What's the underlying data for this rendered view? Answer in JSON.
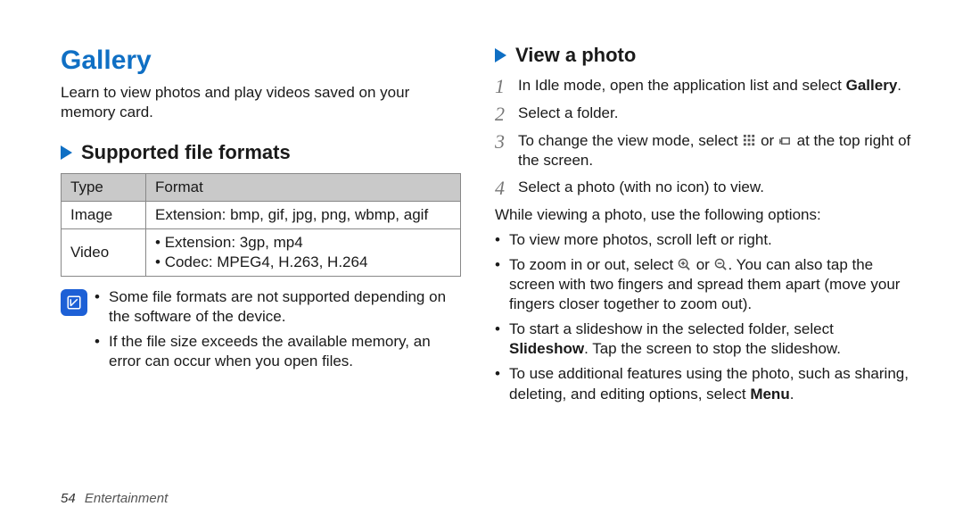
{
  "left": {
    "title": "Gallery",
    "intro": "Learn to view photos and play videos saved on your memory card.",
    "section_heading": "Supported file formats",
    "table": {
      "head_type": "Type",
      "head_format": "Format",
      "row_image_type": "Image",
      "row_image_format": "Extension: bmp, gif, jpg, png, wbmp, agif",
      "row_video_type": "Video",
      "row_video_b1": "Extension: 3gp, mp4",
      "row_video_b2": "Codec: MPEG4, H.263, H.264"
    },
    "notes": {
      "n1": "Some file formats are not supported depending on the software of the device.",
      "n2": "If the file size exceeds the available memory, an error can occur when you open files."
    }
  },
  "right": {
    "section_heading": "View a photo",
    "steps": {
      "s1_pre": "In Idle mode, open the application list and select ",
      "s1_bold": "Gallery",
      "s1_post": ".",
      "s2": "Select a folder.",
      "s3_pre": "To change the view mode, select ",
      "s3_mid": " or ",
      "s3_post": " at the top right of the screen.",
      "s4": "Select a photo (with no icon) to view."
    },
    "options_lead": "While viewing a photo, use the following options:",
    "opts": {
      "o1": "To view more photos, scroll left or right.",
      "o2_pre": "To zoom in or out, select ",
      "o2_mid": " or ",
      "o2_post": ". You can also tap the screen with two fingers and spread them apart (move your fingers closer together to zoom out).",
      "o3_pre": "To start a slideshow in the selected folder, select ",
      "o3_bold": "Slideshow",
      "o3_post": ". Tap the screen to stop the slideshow.",
      "o4_pre": "To use additional features using the photo, such as sharing, deleting, and editing options, select ",
      "o4_bold": "Menu",
      "o4_post": "."
    }
  },
  "footer": {
    "page_number": "54",
    "section": "Entertainment"
  }
}
